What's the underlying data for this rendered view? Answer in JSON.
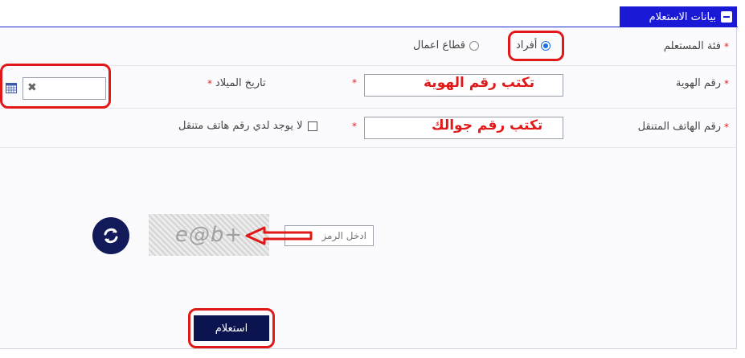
{
  "section": {
    "title": "بيانات الاستعلام"
  },
  "form": {
    "category_label": "فئة المستعلم",
    "category_options": {
      "individuals": "أفراد",
      "business": "قطاع اعمال"
    },
    "required_mark": "*",
    "id_label": "رقم الهوية",
    "id_hint": "تكتب رقم الهوية",
    "birthdate_label": "تاريخ الميلاد",
    "mobile_label": "رقم الهاتف المتنقل",
    "mobile_hint": "تكتب رقم جوالك",
    "no_mobile_label": "لا يوجد لدي رقم هاتف متنقل",
    "captcha_placeholder": "ادخل الرمز",
    "captcha_text": "e@b+",
    "submit_label": "استعلام"
  },
  "colors": {
    "accent": "#1a1ad6",
    "annotation_red": "#e01818",
    "button": "#0c1450"
  },
  "icons": {
    "collapse": "minus-square-icon",
    "clear": "x-icon",
    "calendar": "calendar-icon",
    "refresh": "refresh-icon",
    "arrow": "arrow-left-icon"
  }
}
